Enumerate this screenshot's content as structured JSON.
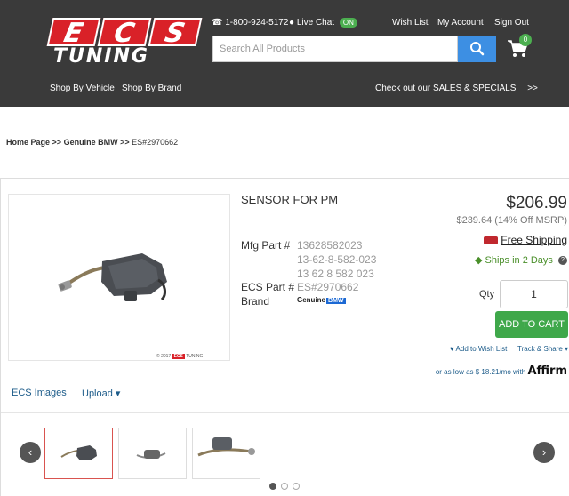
{
  "header": {
    "logo_top": "ECS",
    "logo_bottom": "TUNING",
    "phone": "1-800-924-5172",
    "live_chat": "Live Chat",
    "chat_status": "ON",
    "wish_list": "Wish List",
    "my_account": "My Account",
    "sign_out": "Sign Out",
    "search_placeholder": "Search All Products",
    "cart_count": "0",
    "nav_vehicle": "Shop By Vehicle",
    "nav_brand": "Shop By Brand",
    "sales_link": "Check out our SALES & SPECIALS",
    "sales_arrow": ">>"
  },
  "breadcrumb": {
    "home": "Home Page",
    "sep1": ">>",
    "genuine": "Genuine BMW",
    "sep2": ">>",
    "current": "ES#2970662"
  },
  "product": {
    "title": "SENSOR FOR PM",
    "mfg_label": "Mfg Part #",
    "mfg_values": [
      "13628582023",
      "13-62-8-582-023",
      "13 62 8 582 023"
    ],
    "ecs_label": "ECS Part #",
    "ecs_value": "ES#2970662",
    "brand_label": "Brand",
    "brand_text": "Genuine",
    "brand_mark": "BMW",
    "watermark_year": "© 2017",
    "watermark_ecs": "ECS",
    "watermark_tuning": "TUNING"
  },
  "purchase": {
    "price": "$206.99",
    "msrp": "$239.64",
    "discount": "(14% Off MSRP)",
    "free_shipping": "Free Shipping",
    "ships_in": "Ships in 2 Days",
    "help": "?",
    "qty_label": "Qty",
    "qty_value": "1",
    "add_to_cart": "ADD TO CART",
    "add_wishlist": "Add to Wish List",
    "track_share": "Track & Share",
    "affirm_text": "or as low as $ 18.21/mo with",
    "affirm_brand": "Affirm"
  },
  "tabs": {
    "images": "ECS Images",
    "upload": "Upload"
  },
  "carousel": {
    "prev": "‹",
    "next": "›",
    "active_dot": 0,
    "dot_count": 3
  },
  "colors": {
    "header_bg": "#3a3a3a",
    "brand_red": "#d92128",
    "accent_blue": "#3d8fe3",
    "cart_green": "#3fa84a",
    "link_blue": "#1d5c8a"
  },
  "icons": [
    "phone-icon",
    "chat-icon",
    "search-icon",
    "cart-icon",
    "truck-icon",
    "tag-icon",
    "heart-icon",
    "caret-down-icon"
  ]
}
